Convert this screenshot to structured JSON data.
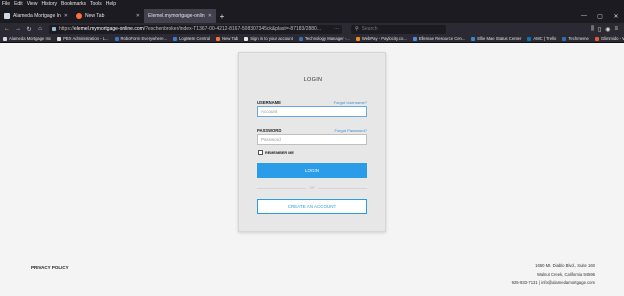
{
  "menubar": [
    "File",
    "Edit",
    "View",
    "History",
    "Bookmarks",
    "Tools",
    "Help"
  ],
  "tabs": [
    {
      "title": "Alameda Mortgage Inc",
      "active": false,
      "icon": "window-icon"
    },
    {
      "title": "New Tab",
      "active": false,
      "icon": "firefox-icon"
    },
    {
      "title": "Elemel.mymortgage-online.co",
      "active": true,
      "icon": "site-icon"
    }
  ],
  "window_controls": [
    "—",
    "▢",
    "✕"
  ],
  "address_bar": {
    "url_prefix": "https://",
    "url_domain": "elemel.mymortgage-online.com",
    "url_rest": "/?eschenbroker/index-T1367-00-4212-8167-508307345ck&plast=-87183/2880..."
  },
  "search": {
    "placeholder": "Search"
  },
  "bookmarks": [
    {
      "label": "Alameda Mortgage Inc",
      "color": "#cfd8e6"
    },
    {
      "label": "PBX Administration - L...",
      "color": "#d9d9d9"
    },
    {
      "label": "RoboForm Everywhere...",
      "color": "#3b73c8"
    },
    {
      "label": "LogMeIn Central",
      "color": "#3a7bd5"
    },
    {
      "label": "New Tab",
      "color": "#ff7139"
    },
    {
      "label": "Sign in to your account",
      "color": "#e9e9e9"
    },
    {
      "label": "Technology Manager -...",
      "color": "#3572b0"
    },
    {
      "label": "WebPay - Paylocity.co...",
      "color": "#f28b1a"
    },
    {
      "label": "Ellemae Resource Cen...",
      "color": "#4a90d9"
    },
    {
      "label": "Ellie Mae Status Center",
      "color": "#3a87c9"
    },
    {
      "label": "AMC | Trello",
      "color": "#0079bf"
    },
    {
      "label": "Techmeme",
      "color": "#2e6db4"
    },
    {
      "label": "Glimmido - We come f...",
      "color": "#e55a39"
    }
  ],
  "login": {
    "title": "LOGIN",
    "username_label": "USERNAME",
    "forgot_username": "Forgot Username?",
    "username_placeholder": "Account",
    "password_label": "PASSWORD",
    "forgot_password": "Forgot Password?",
    "password_placeholder": "Password",
    "remember_label": "REMEMBER ME",
    "login_button": "LOGIN",
    "or_text": "OR",
    "create_button": "CREATE AN ACCOUNT"
  },
  "footer": {
    "privacy": "PRIVACY POLICY",
    "address_line1": "1650 Mt. Diablo Blvd., Suite 160",
    "address_line2": "Walnut Creek, California 94596",
    "phone": "925-933-7131",
    "separator": "|",
    "email": "info@alamedamortgage.com"
  },
  "colors": {
    "accent": "#2a9ce8",
    "link": "#3a8fd3",
    "chrome_dark": "#1c1b22"
  }
}
